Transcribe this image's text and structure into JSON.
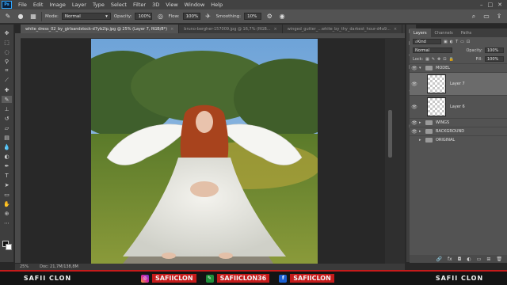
{
  "app": {
    "logo": "Ps"
  },
  "menu": [
    "File",
    "Edit",
    "Image",
    "Layer",
    "Type",
    "Select",
    "Filter",
    "3D",
    "View",
    "Window",
    "Help"
  ],
  "window_controls": [
    "–",
    "□",
    "✕"
  ],
  "options": {
    "mode_label": "Mode:",
    "mode_value": "Normal",
    "opacity_label": "Opacity:",
    "opacity_value": "100%",
    "flow_label": "Flow:",
    "flow_value": "100%",
    "smoothing_label": "Smoothing:",
    "smoothing_value": "10%"
  },
  "tabs": [
    {
      "label": "white_dress_02_by_girlsandstock-d7yb2lp.jpg @ 25% (Layer 7, RGB/8*)",
      "close": "×"
    },
    {
      "label": "bruno-bergher-157009.jpg @ 16,7% (RGB...",
      "close": "×"
    },
    {
      "label": "winged_gutter_...white_by_thy_darkest_hour-d4a9...",
      "close": "×"
    }
  ],
  "status": {
    "zoom": "25%",
    "doc": "Doc: 21,7M/138,8M"
  },
  "layers_panel": {
    "tabs": [
      "Layers",
      "Channels",
      "Paths"
    ],
    "filter_value": "Kind",
    "blend_mode": "Normal",
    "opacity_label": "Opacity:",
    "opacity_value": "100%",
    "lock_label": "Lock:",
    "fill_label": "Fill:",
    "fill_value": "100%",
    "layers": [
      {
        "name": "MODEL",
        "kind": "group"
      },
      {
        "name": "Layer 7",
        "kind": "layer"
      },
      {
        "name": "Layer 6",
        "kind": "layer"
      },
      {
        "name": "WINGS",
        "kind": "group"
      },
      {
        "name": "BACKGROUND",
        "kind": "group"
      },
      {
        "name": "ORIGINAL",
        "kind": "group"
      }
    ]
  },
  "banner": {
    "brand_left": "SAFII CLON",
    "instagram": "SAFIICLON",
    "web": "SAFIICLON36",
    "facebook": "SAFIICLON",
    "brand_right": "SAFII CLON"
  }
}
